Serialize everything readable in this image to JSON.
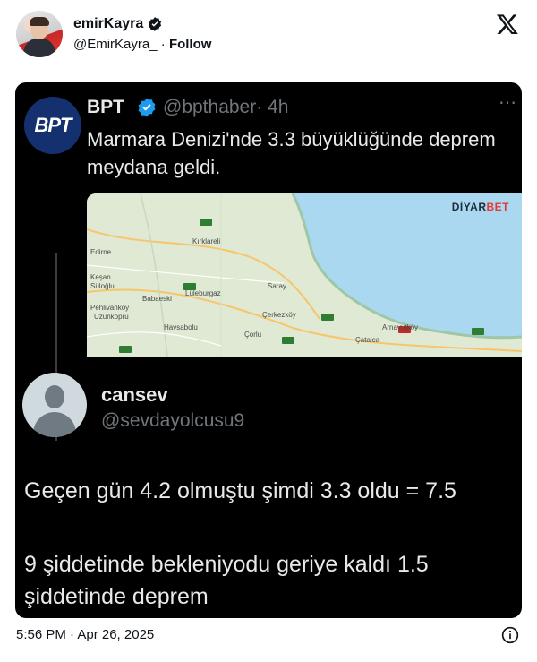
{
  "post": {
    "author_name": "emirKayra",
    "author_handle": "@EmirKayra_",
    "separator": "·",
    "follow_label": "Follow",
    "timestamp": "5:56 PM · Apr 26, 2025"
  },
  "embedded": {
    "quoted": {
      "name": "BPT",
      "avatar_text": "BPT",
      "handle": "@bpthaber",
      "time": "· 4h",
      "more": "⋯",
      "text": "Marmara Denizi'nde 3.3 büyüklüğünde deprem meydana geldi.",
      "map_brand_dark": "DİYAR",
      "map_brand_red": "BET",
      "map_labels": [
        "Kırklareli",
        "Edirne",
        "Babaeski",
        "Lüleburgaz",
        "Uzunköprü",
        "Havsabolu",
        "Saray",
        "Çerkezköy",
        "Çorlu",
        "Çatalca",
        "Arnavutköy",
        "Keşan",
        "Süloğlu",
        "Pehlivanköy"
      ]
    },
    "reply": {
      "name": "cansev",
      "handle": "@sevdayolcusu9",
      "line1": "Geçen gün 4.2 olmuştu şimdi 3.3 oldu = 7.5",
      "line2": "9 şiddetinde bekleniyodu geriye kaldı 1.5 şiddetinde deprem"
    }
  },
  "colors": {
    "accent": "#1d9bf0",
    "dark_bg": "#000000",
    "muted": "#71767b",
    "sea": "#aad8f0"
  },
  "icons": {
    "logo": "x-logo-icon",
    "verified": "verified-badge-icon",
    "info": "info-icon"
  }
}
